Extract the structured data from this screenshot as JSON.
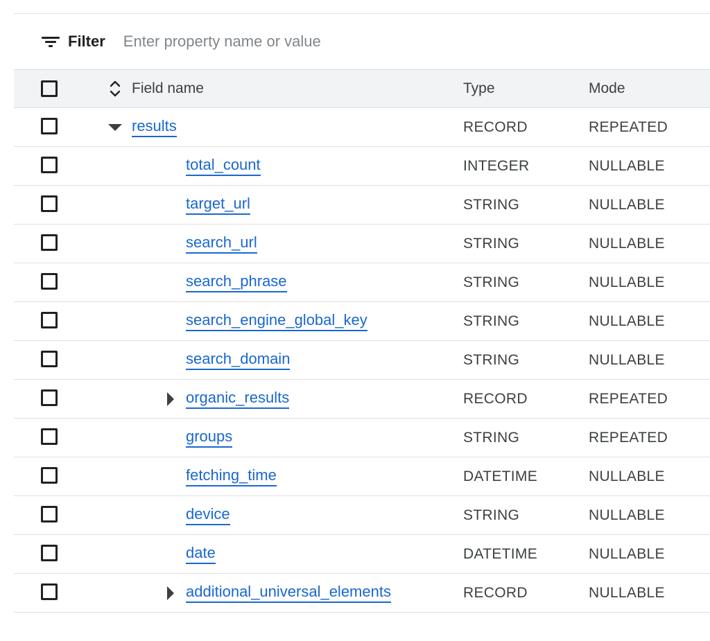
{
  "filter": {
    "label": "Filter",
    "placeholder": "Enter property name or value",
    "icon": "filter-list-icon"
  },
  "columns": {
    "field_name": "Field name",
    "type": "Type",
    "mode": "Mode"
  },
  "rows": [
    {
      "name": "results",
      "type": "RECORD",
      "mode": "REPEATED",
      "level": 0,
      "expander": "expanded"
    },
    {
      "name": "total_count",
      "type": "INTEGER",
      "mode": "NULLABLE",
      "level": 1,
      "expander": "none"
    },
    {
      "name": "target_url",
      "type": "STRING",
      "mode": "NULLABLE",
      "level": 1,
      "expander": "none"
    },
    {
      "name": "search_url",
      "type": "STRING",
      "mode": "NULLABLE",
      "level": 1,
      "expander": "none"
    },
    {
      "name": "search_phrase",
      "type": "STRING",
      "mode": "NULLABLE",
      "level": 1,
      "expander": "none"
    },
    {
      "name": "search_engine_global_key",
      "type": "STRING",
      "mode": "NULLABLE",
      "level": 1,
      "expander": "none"
    },
    {
      "name": "search_domain",
      "type": "STRING",
      "mode": "NULLABLE",
      "level": 1,
      "expander": "none"
    },
    {
      "name": "organic_results",
      "type": "RECORD",
      "mode": "REPEATED",
      "level": 1,
      "expander": "collapsed"
    },
    {
      "name": "groups",
      "type": "STRING",
      "mode": "REPEATED",
      "level": 1,
      "expander": "none"
    },
    {
      "name": "fetching_time",
      "type": "DATETIME",
      "mode": "NULLABLE",
      "level": 1,
      "expander": "none"
    },
    {
      "name": "device",
      "type": "STRING",
      "mode": "NULLABLE",
      "level": 1,
      "expander": "none"
    },
    {
      "name": "date",
      "type": "DATETIME",
      "mode": "NULLABLE",
      "level": 1,
      "expander": "none"
    },
    {
      "name": "additional_universal_elements",
      "type": "RECORD",
      "mode": "NULLABLE",
      "level": 1,
      "expander": "collapsed"
    }
  ],
  "colors": {
    "link": "#1967d2",
    "header_bg": "#f1f3f4",
    "text": "#202124",
    "muted": "#80868b"
  }
}
